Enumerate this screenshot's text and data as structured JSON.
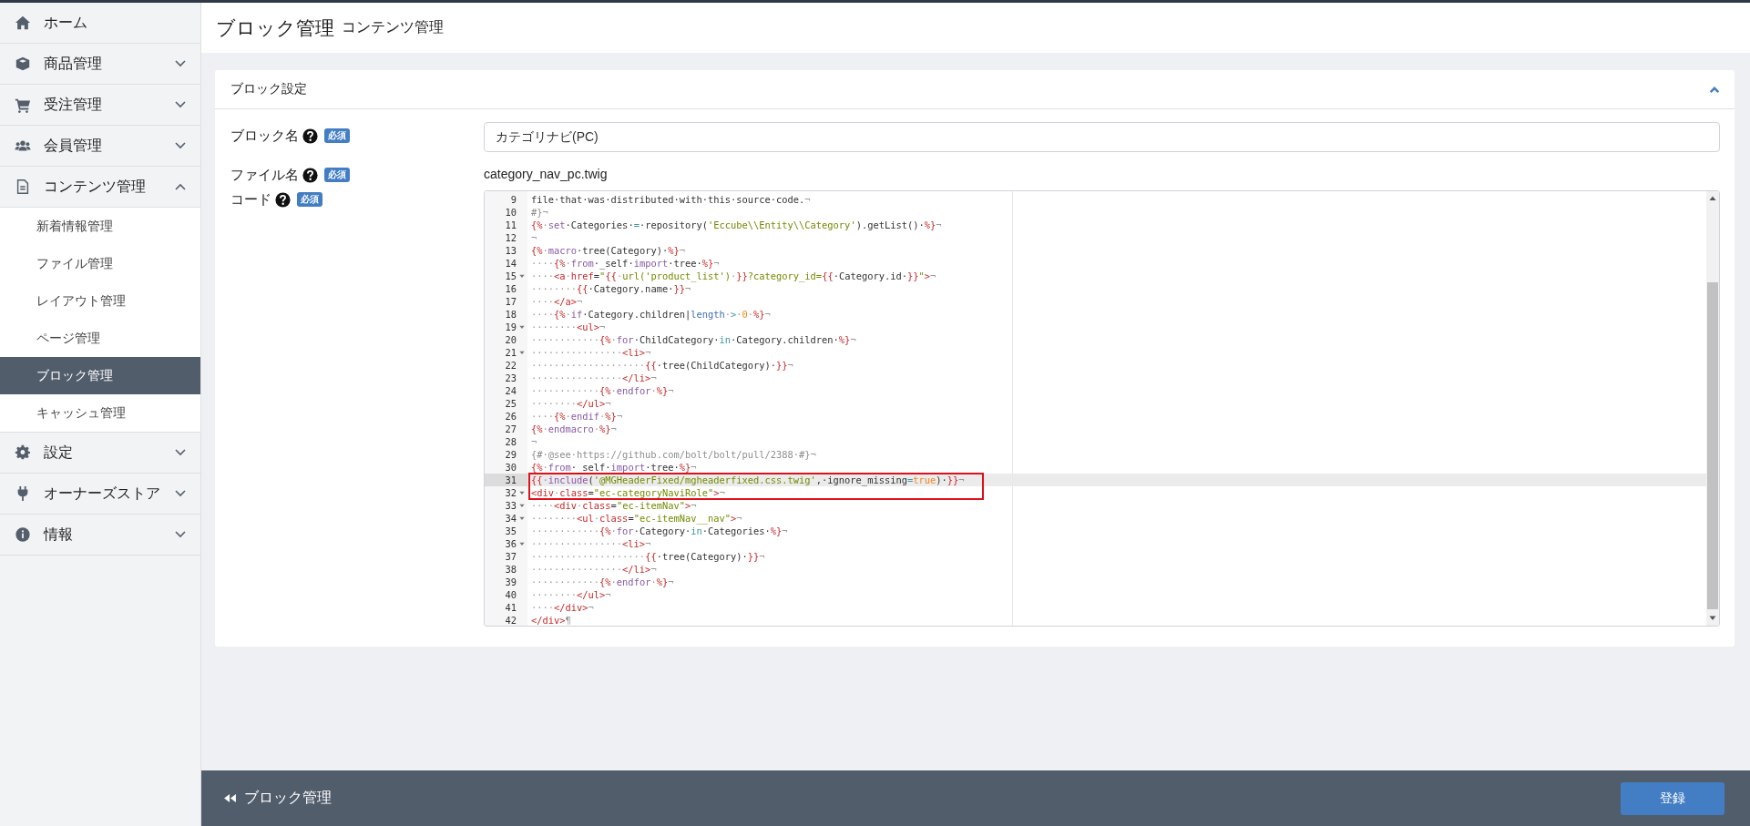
{
  "sidebar": {
    "items": [
      {
        "label": "ホーム",
        "expandable": false
      },
      {
        "label": "商品管理",
        "expandable": true,
        "expanded": false
      },
      {
        "label": "受注管理",
        "expandable": true,
        "expanded": false
      },
      {
        "label": "会員管理",
        "expandable": true,
        "expanded": false
      },
      {
        "label": "コンテンツ管理",
        "expandable": true,
        "expanded": true,
        "children": [
          {
            "label": "新着情報管理",
            "selected": false
          },
          {
            "label": "ファイル管理",
            "selected": false
          },
          {
            "label": "レイアウト管理",
            "selected": false
          },
          {
            "label": "ページ管理",
            "selected": false
          },
          {
            "label": "ブロック管理",
            "selected": true
          },
          {
            "label": "キャッシュ管理",
            "selected": false
          }
        ]
      },
      {
        "label": "設定",
        "expandable": true,
        "expanded": false
      },
      {
        "label": "オーナーズストア",
        "expandable": true,
        "expanded": false
      },
      {
        "label": "情報",
        "expandable": true,
        "expanded": false
      }
    ]
  },
  "header": {
    "title": "ブロック管理",
    "subtitle": "コンテンツ管理"
  },
  "card": {
    "title": "ブロック設定",
    "expanded": true,
    "fields": [
      {
        "kind": "input",
        "label": "ブロック名",
        "badge": "必須",
        "value": "カテゴリナビ(PC)"
      },
      {
        "kind": "text",
        "label": "ファイル名",
        "badge": "必須",
        "value": "category_nav_pc.twig"
      },
      {
        "kind": "code",
        "label": "コード",
        "badge": "必須"
      }
    ]
  },
  "code": {
    "lines": [
      {
        "num": "9",
        "fold": false,
        "active": false,
        "boxed": false,
        "tokens": [
          {
            "t": "file·that·was·distributed·with·this·source·code.",
            "kind": "plain"
          },
          {
            "t": "¬",
            "kind": "space"
          }
        ]
      },
      {
        "num": "10",
        "fold": false,
        "active": false,
        "boxed": false,
        "tokens": [
          {
            "t": "#}",
            "kind": "comment"
          },
          {
            "t": "¬",
            "kind": "space"
          }
        ]
      },
      {
        "num": "11",
        "fold": false,
        "active": false,
        "boxed": false,
        "tokens": [
          {
            "t": "{%",
            "kind": "tag"
          },
          {
            "t": "·",
            "kind": "space"
          },
          {
            "t": "set",
            "kind": "keyword"
          },
          {
            "t": "·Categories·",
            "kind": "plain"
          },
          {
            "t": "=",
            "kind": "operator"
          },
          {
            "t": "·repository(",
            "kind": "plain"
          },
          {
            "t": "'Eccube\\\\Entity\\\\Category'",
            "kind": "string"
          },
          {
            "t": ").getList()·",
            "kind": "plain"
          },
          {
            "t": "%}",
            "kind": "tag"
          },
          {
            "t": "¬",
            "kind": "space"
          }
        ]
      },
      {
        "num": "12",
        "fold": false,
        "active": false,
        "boxed": false,
        "tokens": [
          {
            "t": "¬",
            "kind": "space"
          }
        ]
      },
      {
        "num": "13",
        "fold": false,
        "active": false,
        "boxed": false,
        "tokens": [
          {
            "t": "{%",
            "kind": "tag"
          },
          {
            "t": "·",
            "kind": "space"
          },
          {
            "t": "macro",
            "kind": "keyword"
          },
          {
            "t": "·tree(Category)·",
            "kind": "plain"
          },
          {
            "t": "%}",
            "kind": "tag"
          },
          {
            "t": "¬",
            "kind": "space"
          }
        ]
      },
      {
        "num": "14",
        "fold": false,
        "active": false,
        "boxed": false,
        "tokens": [
          {
            "t": "····",
            "kind": "space"
          },
          {
            "t": "{%",
            "kind": "tag"
          },
          {
            "t": "·",
            "kind": "space"
          },
          {
            "t": "from",
            "kind": "keyword"
          },
          {
            "t": "·_self·",
            "kind": "plain"
          },
          {
            "t": "import",
            "kind": "keyword"
          },
          {
            "t": "·tree·",
            "kind": "plain"
          },
          {
            "t": "%}",
            "kind": "tag"
          },
          {
            "t": "¬",
            "kind": "space"
          }
        ]
      },
      {
        "num": "15",
        "fold": true,
        "active": false,
        "boxed": false,
        "tokens": [
          {
            "t": "····",
            "kind": "space"
          },
          {
            "t": "<a",
            "kind": "tag"
          },
          {
            "t": "·",
            "kind": "space"
          },
          {
            "t": "href",
            "kind": "tag"
          },
          {
            "t": "=",
            "kind": "plain"
          },
          {
            "t": "\"",
            "kind": "string"
          },
          {
            "t": "{{",
            "kind": "tag"
          },
          {
            "t": "·",
            "kind": "space"
          },
          {
            "t": "url('product_list')",
            "kind": "string"
          },
          {
            "t": "·",
            "kind": "space"
          },
          {
            "t": "}}",
            "kind": "tag"
          },
          {
            "t": "?category_id=",
            "kind": "string"
          },
          {
            "t": "{{",
            "kind": "tag"
          },
          {
            "t": "·Category.id·",
            "kind": "plain"
          },
          {
            "t": "}}",
            "kind": "tag"
          },
          {
            "t": "\"",
            "kind": "string"
          },
          {
            "t": ">",
            "kind": "tag"
          },
          {
            "t": "¬",
            "kind": "space"
          }
        ]
      },
      {
        "num": "16",
        "fold": false,
        "active": false,
        "boxed": false,
        "tokens": [
          {
            "t": "········",
            "kind": "space"
          },
          {
            "t": "{{",
            "kind": "tag"
          },
          {
            "t": "·Category.name·",
            "kind": "plain"
          },
          {
            "t": "}}",
            "kind": "tag"
          },
          {
            "t": "¬",
            "kind": "space"
          }
        ]
      },
      {
        "num": "17",
        "fold": false,
        "active": false,
        "boxed": false,
        "tokens": [
          {
            "t": "····",
            "kind": "space"
          },
          {
            "t": "</a>",
            "kind": "tag"
          },
          {
            "t": "¬",
            "kind": "space"
          }
        ]
      },
      {
        "num": "18",
        "fold": false,
        "active": false,
        "boxed": false,
        "tokens": [
          {
            "t": "····",
            "kind": "space"
          },
          {
            "t": "{%",
            "kind": "tag"
          },
          {
            "t": "·",
            "kind": "space"
          },
          {
            "t": "if",
            "kind": "keyword"
          },
          {
            "t": "·Category.children|",
            "kind": "plain"
          },
          {
            "t": "length",
            "kind": "filter"
          },
          {
            "t": "·",
            "kind": "space"
          },
          {
            "t": ">",
            "kind": "operator"
          },
          {
            "t": "·",
            "kind": "space"
          },
          {
            "t": "0",
            "kind": "number"
          },
          {
            "t": "·",
            "kind": "space"
          },
          {
            "t": "%}",
            "kind": "tag"
          },
          {
            "t": "¬",
            "kind": "space"
          }
        ]
      },
      {
        "num": "19",
        "fold": true,
        "active": false,
        "boxed": false,
        "tokens": [
          {
            "t": "········",
            "kind": "space"
          },
          {
            "t": "<ul>",
            "kind": "tag"
          },
          {
            "t": "¬",
            "kind": "space"
          }
        ]
      },
      {
        "num": "20",
        "fold": false,
        "active": false,
        "boxed": false,
        "tokens": [
          {
            "t": "············",
            "kind": "space"
          },
          {
            "t": "{%",
            "kind": "tag"
          },
          {
            "t": "·",
            "kind": "space"
          },
          {
            "t": "for",
            "kind": "keyword"
          },
          {
            "t": "·ChildCategory·",
            "kind": "plain"
          },
          {
            "t": "in",
            "kind": "operator"
          },
          {
            "t": "·Category.children·",
            "kind": "plain"
          },
          {
            "t": "%}",
            "kind": "tag"
          },
          {
            "t": "¬",
            "kind": "space"
          }
        ]
      },
      {
        "num": "21",
        "fold": true,
        "active": false,
        "boxed": false,
        "tokens": [
          {
            "t": "················",
            "kind": "space"
          },
          {
            "t": "<li>",
            "kind": "tag"
          },
          {
            "t": "¬",
            "kind": "space"
          }
        ]
      },
      {
        "num": "22",
        "fold": false,
        "active": false,
        "boxed": false,
        "tokens": [
          {
            "t": "····················",
            "kind": "space"
          },
          {
            "t": "{{",
            "kind": "tag"
          },
          {
            "t": "·tree(ChildCategory)·",
            "kind": "plain"
          },
          {
            "t": "}}",
            "kind": "tag"
          },
          {
            "t": "¬",
            "kind": "space"
          }
        ]
      },
      {
        "num": "23",
        "fold": false,
        "active": false,
        "boxed": false,
        "tokens": [
          {
            "t": "················",
            "kind": "space"
          },
          {
            "t": "</li>",
            "kind": "tag"
          },
          {
            "t": "¬",
            "kind": "space"
          }
        ]
      },
      {
        "num": "24",
        "fold": false,
        "active": false,
        "boxed": false,
        "tokens": [
          {
            "t": "············",
            "kind": "space"
          },
          {
            "t": "{%",
            "kind": "tag"
          },
          {
            "t": "·",
            "kind": "space"
          },
          {
            "t": "endfor",
            "kind": "keyword"
          },
          {
            "t": "·",
            "kind": "space"
          },
          {
            "t": "%}",
            "kind": "tag"
          },
          {
            "t": "¬",
            "kind": "space"
          }
        ]
      },
      {
        "num": "25",
        "fold": false,
        "active": false,
        "boxed": false,
        "tokens": [
          {
            "t": "········",
            "kind": "space"
          },
          {
            "t": "</ul>",
            "kind": "tag"
          },
          {
            "t": "¬",
            "kind": "space"
          }
        ]
      },
      {
        "num": "26",
        "fold": false,
        "active": false,
        "boxed": false,
        "tokens": [
          {
            "t": "····",
            "kind": "space"
          },
          {
            "t": "{%",
            "kind": "tag"
          },
          {
            "t": "·",
            "kind": "space"
          },
          {
            "t": "endif",
            "kind": "keyword"
          },
          {
            "t": "·",
            "kind": "space"
          },
          {
            "t": "%}",
            "kind": "tag"
          },
          {
            "t": "¬",
            "kind": "space"
          }
        ]
      },
      {
        "num": "27",
        "fold": false,
        "active": false,
        "boxed": false,
        "tokens": [
          {
            "t": "{%",
            "kind": "tag"
          },
          {
            "t": "·",
            "kind": "space"
          },
          {
            "t": "endmacro",
            "kind": "keyword"
          },
          {
            "t": "·",
            "kind": "space"
          },
          {
            "t": "%}",
            "kind": "tag"
          },
          {
            "t": "¬",
            "kind": "space"
          }
        ]
      },
      {
        "num": "28",
        "fold": false,
        "active": false,
        "boxed": false,
        "tokens": [
          {
            "t": "¬",
            "kind": "space"
          }
        ]
      },
      {
        "num": "29",
        "fold": false,
        "active": false,
        "boxed": false,
        "tokens": [
          {
            "t": "{#·@see·https://github.com/bolt/bolt/pull/2388·#}",
            "kind": "comment"
          },
          {
            "t": "¬",
            "kind": "space"
          }
        ]
      },
      {
        "num": "30",
        "fold": false,
        "active": false,
        "boxed": false,
        "tokens": [
          {
            "t": "{%",
            "kind": "tag"
          },
          {
            "t": "·",
            "kind": "space"
          },
          {
            "t": "from",
            "kind": "keyword"
          },
          {
            "t": "·_self·",
            "kind": "plain"
          },
          {
            "t": "import",
            "kind": "keyword"
          },
          {
            "t": "·tree·",
            "kind": "plain"
          },
          {
            "t": "%}",
            "kind": "tag"
          },
          {
            "t": "¬",
            "kind": "space"
          }
        ]
      },
      {
        "num": "31",
        "fold": false,
        "active": true,
        "boxed": true,
        "tokens": [
          {
            "t": "{{",
            "kind": "tag"
          },
          {
            "t": "·",
            "kind": "space"
          },
          {
            "t": "include",
            "kind": "keyword"
          },
          {
            "t": "(",
            "kind": "plain"
          },
          {
            "t": "'@MGHeaderFixed/mgheaderfixed.css.twig'",
            "kind": "string"
          },
          {
            "t": ",·ignore_missing",
            "kind": "plain"
          },
          {
            "t": "=",
            "kind": "operator"
          },
          {
            "t": "true",
            "kind": "number"
          },
          {
            "t": ")·",
            "kind": "plain"
          },
          {
            "t": "}}",
            "kind": "tag"
          },
          {
            "t": "¬",
            "kind": "space"
          }
        ]
      },
      {
        "num": "32",
        "fold": true,
        "active": false,
        "boxed": true,
        "tokens": [
          {
            "t": "<div",
            "kind": "tag"
          },
          {
            "t": "·",
            "kind": "space"
          },
          {
            "t": "class",
            "kind": "tag"
          },
          {
            "t": "=",
            "kind": "plain"
          },
          {
            "t": "\"ec-categoryNaviRole\"",
            "kind": "string"
          },
          {
            "t": ">",
            "kind": "tag"
          },
          {
            "t": "¬",
            "kind": "space"
          }
        ]
      },
      {
        "num": "33",
        "fold": true,
        "active": false,
        "boxed": false,
        "tokens": [
          {
            "t": "····",
            "kind": "space"
          },
          {
            "t": "<div",
            "kind": "tag"
          },
          {
            "t": "·",
            "kind": "space"
          },
          {
            "t": "class",
            "kind": "tag"
          },
          {
            "t": "=",
            "kind": "plain"
          },
          {
            "t": "\"ec-itemNav\"",
            "kind": "string"
          },
          {
            "t": ">",
            "kind": "tag"
          },
          {
            "t": "¬",
            "kind": "space"
          }
        ]
      },
      {
        "num": "34",
        "fold": true,
        "active": false,
        "boxed": false,
        "tokens": [
          {
            "t": "········",
            "kind": "space"
          },
          {
            "t": "<ul",
            "kind": "tag"
          },
          {
            "t": "·",
            "kind": "space"
          },
          {
            "t": "class",
            "kind": "tag"
          },
          {
            "t": "=",
            "kind": "plain"
          },
          {
            "t": "\"ec-itemNav__nav\"",
            "kind": "string"
          },
          {
            "t": ">",
            "kind": "tag"
          },
          {
            "t": "¬",
            "kind": "space"
          }
        ]
      },
      {
        "num": "35",
        "fold": false,
        "active": false,
        "boxed": false,
        "tokens": [
          {
            "t": "············",
            "kind": "space"
          },
          {
            "t": "{%",
            "kind": "tag"
          },
          {
            "t": "·",
            "kind": "space"
          },
          {
            "t": "for",
            "kind": "keyword"
          },
          {
            "t": "·Category·",
            "kind": "plain"
          },
          {
            "t": "in",
            "kind": "operator"
          },
          {
            "t": "·Categories·",
            "kind": "plain"
          },
          {
            "t": "%}",
            "kind": "tag"
          },
          {
            "t": "¬",
            "kind": "space"
          }
        ]
      },
      {
        "num": "36",
        "fold": true,
        "active": false,
        "boxed": false,
        "tokens": [
          {
            "t": "················",
            "kind": "space"
          },
          {
            "t": "<li>",
            "kind": "tag"
          },
          {
            "t": "¬",
            "kind": "space"
          }
        ]
      },
      {
        "num": "37",
        "fold": false,
        "active": false,
        "boxed": false,
        "tokens": [
          {
            "t": "····················",
            "kind": "space"
          },
          {
            "t": "{{",
            "kind": "tag"
          },
          {
            "t": "·tree(Category)·",
            "kind": "plain"
          },
          {
            "t": "}}",
            "kind": "tag"
          },
          {
            "t": "¬",
            "kind": "space"
          }
        ]
      },
      {
        "num": "38",
        "fold": false,
        "active": false,
        "boxed": false,
        "tokens": [
          {
            "t": "················",
            "kind": "space"
          },
          {
            "t": "</li>",
            "kind": "tag"
          },
          {
            "t": "¬",
            "kind": "space"
          }
        ]
      },
      {
        "num": "39",
        "fold": false,
        "active": false,
        "boxed": false,
        "tokens": [
          {
            "t": "············",
            "kind": "space"
          },
          {
            "t": "{%",
            "kind": "tag"
          },
          {
            "t": "·",
            "kind": "space"
          },
          {
            "t": "endfor",
            "kind": "keyword"
          },
          {
            "t": "·",
            "kind": "space"
          },
          {
            "t": "%}",
            "kind": "tag"
          },
          {
            "t": "¬",
            "kind": "space"
          }
        ]
      },
      {
        "num": "40",
        "fold": false,
        "active": false,
        "boxed": false,
        "tokens": [
          {
            "t": "········",
            "kind": "space"
          },
          {
            "t": "</ul>",
            "kind": "tag"
          },
          {
            "t": "¬",
            "kind": "space"
          }
        ]
      },
      {
        "num": "41",
        "fold": false,
        "active": false,
        "boxed": false,
        "tokens": [
          {
            "t": "····",
            "kind": "space"
          },
          {
            "t": "</div>",
            "kind": "tag"
          },
          {
            "t": "¬",
            "kind": "space"
          }
        ]
      },
      {
        "num": "42",
        "fold": false,
        "active": false,
        "boxed": false,
        "tokens": [
          {
            "t": "</div>",
            "kind": "tag"
          },
          {
            "t": "¶",
            "kind": "space"
          }
        ]
      }
    ]
  },
  "footer": {
    "back_link": "ブロック管理",
    "submit": "登録"
  }
}
